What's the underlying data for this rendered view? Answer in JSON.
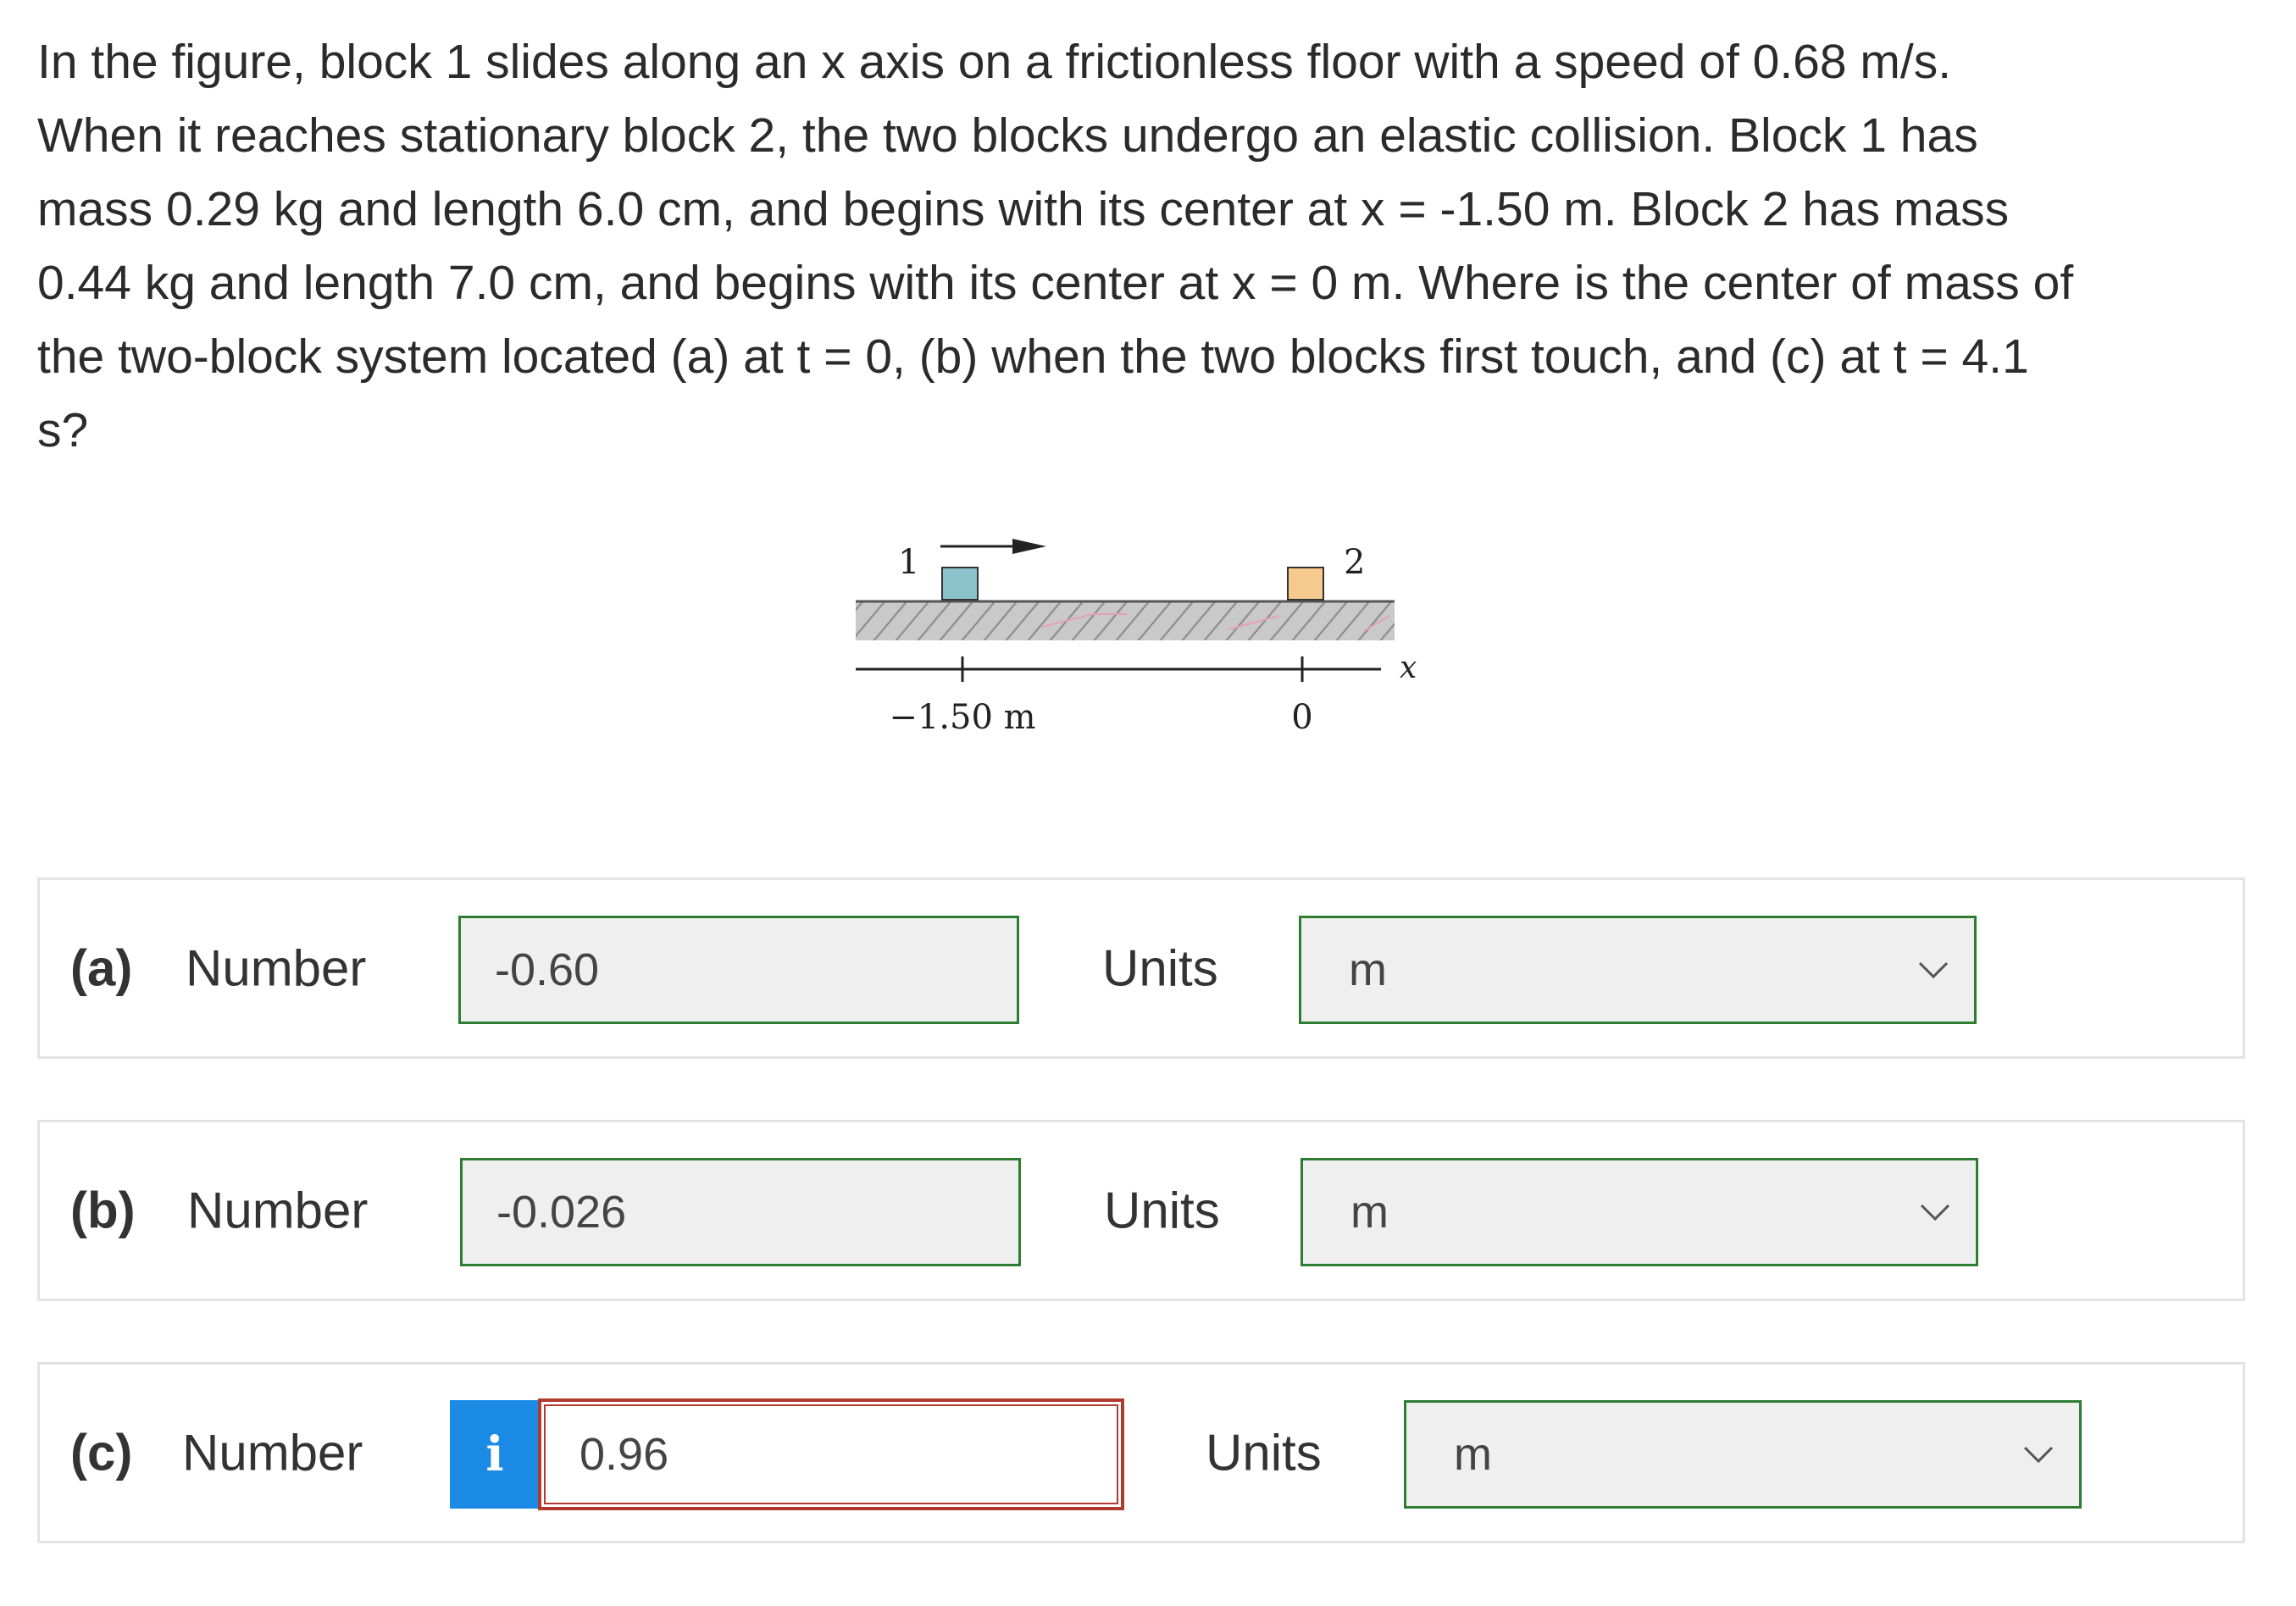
{
  "question": {
    "line1": "In the figure, block 1 slides along an x axis on a frictionless floor with a speed of 0.68 m/s.",
    "line2": "When it reaches stationary block 2, the two blocks undergo an elastic collision. Block 1 has",
    "line3": "mass 0.29 kg and length 6.0 cm, and begins with its center at x = -1.50 m. Block 2 has mass",
    "line4": "0.44 kg and length 7.0 cm, and begins with its center at x = 0 m. Where is the center of mass of",
    "line5": "the two-block system located (a) at t = 0, (b) when the two blocks first touch, and (c) at t = 4.1",
    "line6": "s?"
  },
  "figure": {
    "block1_label": "1",
    "block2_label": "2",
    "axis_label": "x",
    "tick_left": "−1.50 m",
    "tick_right": "0",
    "colors": {
      "block1": "#8cc2cc",
      "block2": "#f6c98f",
      "floor": "#b5b5b5",
      "accent_pink": "#e6a0b4"
    }
  },
  "answers": [
    {
      "part": "(a)",
      "number_label": "Number",
      "value": "-0.60",
      "units_label": "Units",
      "unit": "m",
      "status": "correct"
    },
    {
      "part": "(b)",
      "number_label": "Number",
      "value": "-0.026",
      "units_label": "Units",
      "unit": "m",
      "status": "correct"
    },
    {
      "part": "(c)",
      "number_label": "Number",
      "value": "0.96",
      "units_label": "Units",
      "unit": "m",
      "status": "incorrect",
      "info_icon": "i"
    }
  ]
}
